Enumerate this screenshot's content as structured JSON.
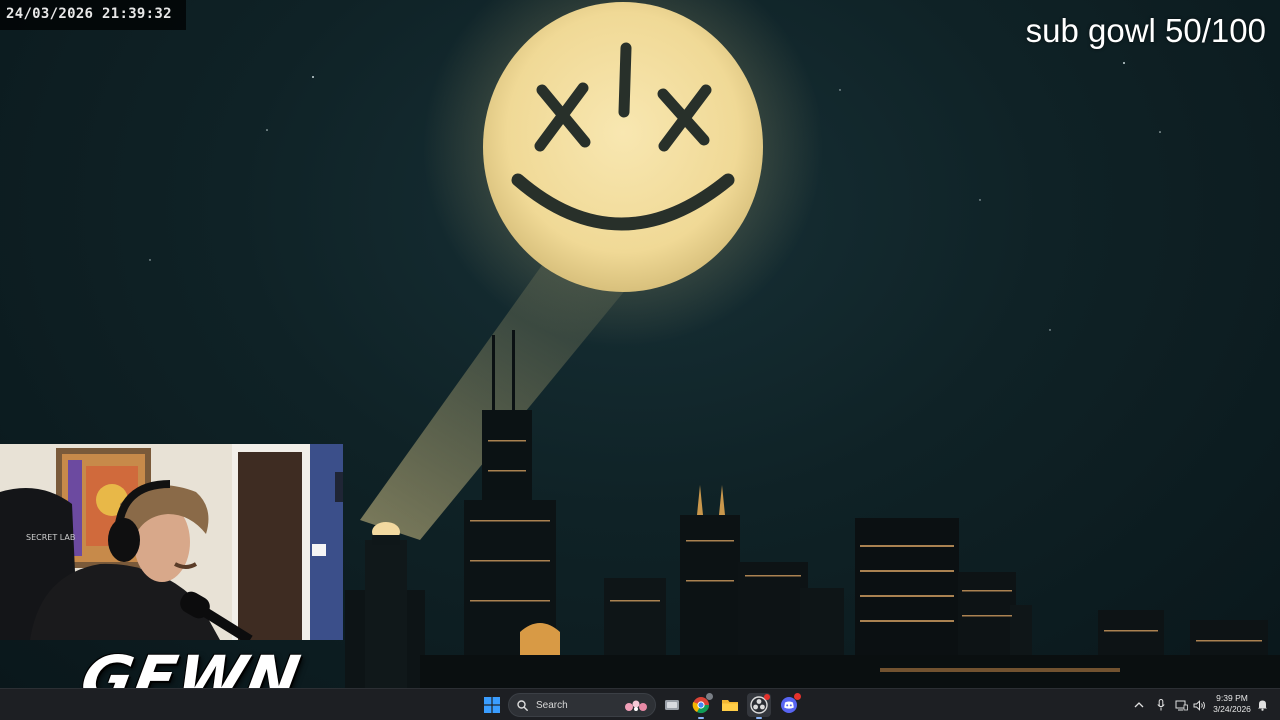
{
  "overlay": {
    "timestamp": "24/03/2026 21:39:32",
    "sub_goal": "sub gowl 50/100"
  },
  "webcam": {
    "chair_brand": "SECRET LAB"
  },
  "brand_logo": {
    "text": "GEWN"
  },
  "taskbar": {
    "search_label": "Search",
    "apps": [
      {
        "name": "Task View",
        "icon": "task-view-icon"
      },
      {
        "name": "Chrome",
        "icon": "chrome-icon"
      },
      {
        "name": "File Explorer",
        "icon": "folder-icon"
      },
      {
        "name": "OBS",
        "icon": "obs-icon"
      },
      {
        "name": "Discord",
        "icon": "discord-icon"
      }
    ],
    "tray": {
      "time": "9:39 PM",
      "date": "3/24/2026"
    }
  },
  "colors": {
    "taskbar_bg": "#1d1f23",
    "signal_glow": "#f3dfa0",
    "windows_blue": "#3a9dff",
    "discord": "#5865f2"
  }
}
